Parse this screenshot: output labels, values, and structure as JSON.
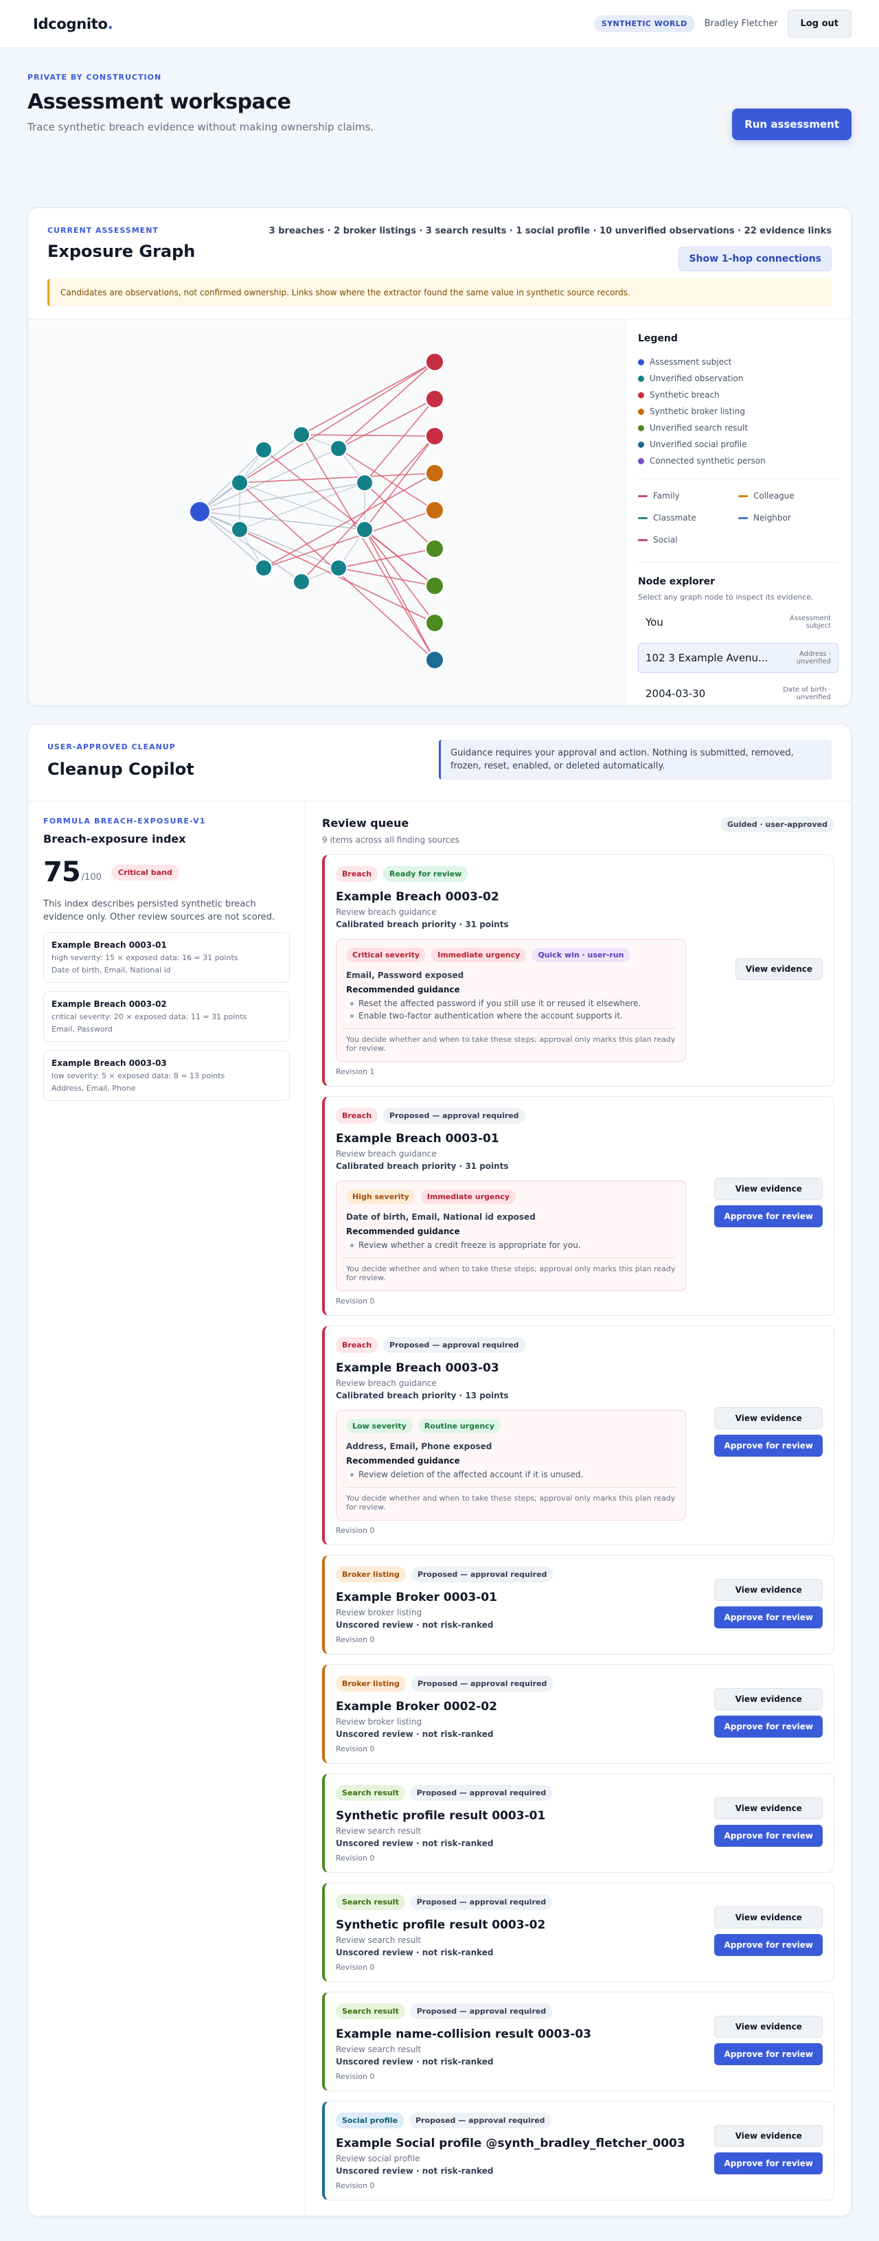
{
  "topbar": {
    "brand": "Idcognito",
    "brand_dot": ".",
    "world_badge": "SYNTHETIC WORLD",
    "user_name": "Bradley Fletcher",
    "logout": "Log out"
  },
  "hero": {
    "eyebrow": "PRIVATE BY CONSTRUCTION",
    "title": "Assessment workspace",
    "subtitle": "Trace synthetic breach evidence without making ownership claims.",
    "run_button": "Run assessment"
  },
  "graph": {
    "eyebrow": "CURRENT ASSESSMENT",
    "title": "Exposure Graph",
    "stats": "3 breaches · 2 broker listings · 3 search results · 1 social profile · 10 unverified observations · 22 evidence links",
    "hop_button": "Show 1-hop connections",
    "notice": "Candidates are observations, not confirmed ownership. Links show where the extractor found the same value in synthetic source records.",
    "colors": {
      "subject": "#2f55d4",
      "observation": "#14808a",
      "breach": "#c62e43",
      "broker": "#c96b10",
      "search": "#4d8a1f",
      "social": "#1d6c93",
      "person": "#7b4fc8",
      "edge_evidence": "#d9596c",
      "edge_plain": "#a9b4c4"
    },
    "legend": {
      "title": "Legend",
      "items": [
        {
          "label": "Assessment subject",
          "color": "#2f55d4"
        },
        {
          "label": "Unverified observation",
          "color": "#14808a"
        },
        {
          "label": "Synthetic breach",
          "color": "#c62e43"
        },
        {
          "label": "Synthetic broker listing",
          "color": "#c96b10"
        },
        {
          "label": "Unverified search result",
          "color": "#4d8a1f"
        },
        {
          "label": "Unverified social profile",
          "color": "#1d6c93"
        },
        {
          "label": "Connected synthetic person",
          "color": "#7b4fc8"
        }
      ],
      "relations": [
        {
          "label": "Family",
          "color": "#c04a8a"
        },
        {
          "label": "Colleague",
          "color": "#d58412"
        },
        {
          "label": "Classmate",
          "color": "#2d8a7a"
        },
        {
          "label": "Neighbor",
          "color": "#4a74d6"
        },
        {
          "label": "Social",
          "color": "#c0506c"
        }
      ]
    },
    "explorer": {
      "title": "Node explorer",
      "hint": "Select any graph node to inspect its evidence.",
      "nodes": [
        {
          "name": "You",
          "type": "Assessment subject"
        },
        {
          "name": "102 3 Example Avenu...",
          "type": "Address · unverified"
        },
        {
          "name": "2004-03-30",
          "type": "Date of birth · unverified"
        }
      ]
    }
  },
  "cleanup": {
    "eyebrow": "USER-APPROVED CLEANUP",
    "title": "Cleanup Copilot",
    "guidance": "Guidance requires your approval and action. Nothing is submitted, removed, frozen, reset, enabled, or deleted automatically.",
    "index": {
      "formula": "FORMULA BREACH-EXPOSURE-V1",
      "title": "Breach-exposure index",
      "score": "75",
      "score_max": "/100",
      "band": "Critical band",
      "description": "This index describes persisted synthetic breach evidence only. Other review sources are not scored.",
      "breaches": [
        {
          "title": "Example Breach 0003-01",
          "formula": "high severity: 15 × exposed data: 16 = 31 points",
          "fields": "Date of birth, Email, National id"
        },
        {
          "title": "Example Breach 0003-02",
          "formula": "critical severity: 20 × exposed data: 11 = 31 points",
          "fields": "Email, Password"
        },
        {
          "title": "Example Breach 0003-03",
          "formula": "low severity: 5 × exposed data: 8 = 13 points",
          "fields": "Address, Email, Phone"
        }
      ]
    },
    "queue": {
      "title": "Review queue",
      "count": "9 items across all finding sources",
      "badge": "Guided · user-approved",
      "decide_text": "You decide whether and when to take these steps; approval only marks this plan ready for review.",
      "view_evidence": "View evidence",
      "approve": "Approve for review",
      "items": [
        {
          "kind": "Breach",
          "status": "Ready for review",
          "title": "Example Breach 0003-02",
          "subtitle": "Review breach guidance",
          "priority": "Calibrated breach priority · 31 points",
          "tags": [
            "Critical severity",
            "Immediate urgency",
            "Quick win · user-run"
          ],
          "exposed": "Email, Password exposed",
          "guidance_title": "Recommended guidance",
          "steps": [
            "Reset the affected password if you still use it or reused it elsewhere.",
            "Enable two-factor authentication where the account supports it."
          ],
          "revision": "Revision 1"
        },
        {
          "kind": "Breach",
          "status": "Proposed — approval required",
          "title": "Example Breach 0003-01",
          "subtitle": "Review breach guidance",
          "priority": "Calibrated breach priority · 31 points",
          "tags": [
            "High severity",
            "Immediate urgency"
          ],
          "exposed": "Date of birth, Email, National id exposed",
          "guidance_title": "Recommended guidance",
          "steps": [
            "Review whether a credit freeze is appropriate for you."
          ],
          "revision": "Revision 0"
        },
        {
          "kind": "Breach",
          "status": "Proposed — approval required",
          "title": "Example Breach 0003-03",
          "subtitle": "Review breach guidance",
          "priority": "Calibrated breach priority · 13 points",
          "tags": [
            "Low severity",
            "Routine urgency"
          ],
          "exposed": "Address, Email, Phone exposed",
          "guidance_title": "Recommended guidance",
          "steps": [
            "Review deletion of the affected account if it is unused."
          ],
          "revision": "Revision 0"
        },
        {
          "kind": "Broker listing",
          "status": "Proposed — approval required",
          "title": "Example Broker 0003-01",
          "subtitle": "Review broker listing",
          "priority": "Unscored review · not risk-ranked",
          "revision": "Revision 0"
        },
        {
          "kind": "Broker listing",
          "status": "Proposed — approval required",
          "title": "Example Broker 0002-02",
          "subtitle": "Review broker listing",
          "priority": "Unscored review · not risk-ranked",
          "revision": "Revision 0"
        },
        {
          "kind": "Search result",
          "status": "Proposed — approval required",
          "title": "Synthetic profile result 0003-01",
          "subtitle": "Review search result",
          "priority": "Unscored review · not risk-ranked",
          "revision": "Revision 0"
        },
        {
          "kind": "Search result",
          "status": "Proposed — approval required",
          "title": "Synthetic profile result 0003-02",
          "subtitle": "Review search result",
          "priority": "Unscored review · not risk-ranked",
          "revision": "Revision 0"
        },
        {
          "kind": "Search result",
          "status": "Proposed — approval required",
          "title": "Example name-collision result 0003-03",
          "subtitle": "Review search result",
          "priority": "Unscored review · not risk-ranked",
          "revision": "Revision 0"
        },
        {
          "kind": "Social profile",
          "status": "Proposed — approval required",
          "title": "Example Social profile @synth_bradley_fletcher_0003",
          "subtitle": "Review social profile",
          "priority": "Unscored review · not risk-ranked",
          "revision": "Revision 0"
        }
      ]
    }
  }
}
